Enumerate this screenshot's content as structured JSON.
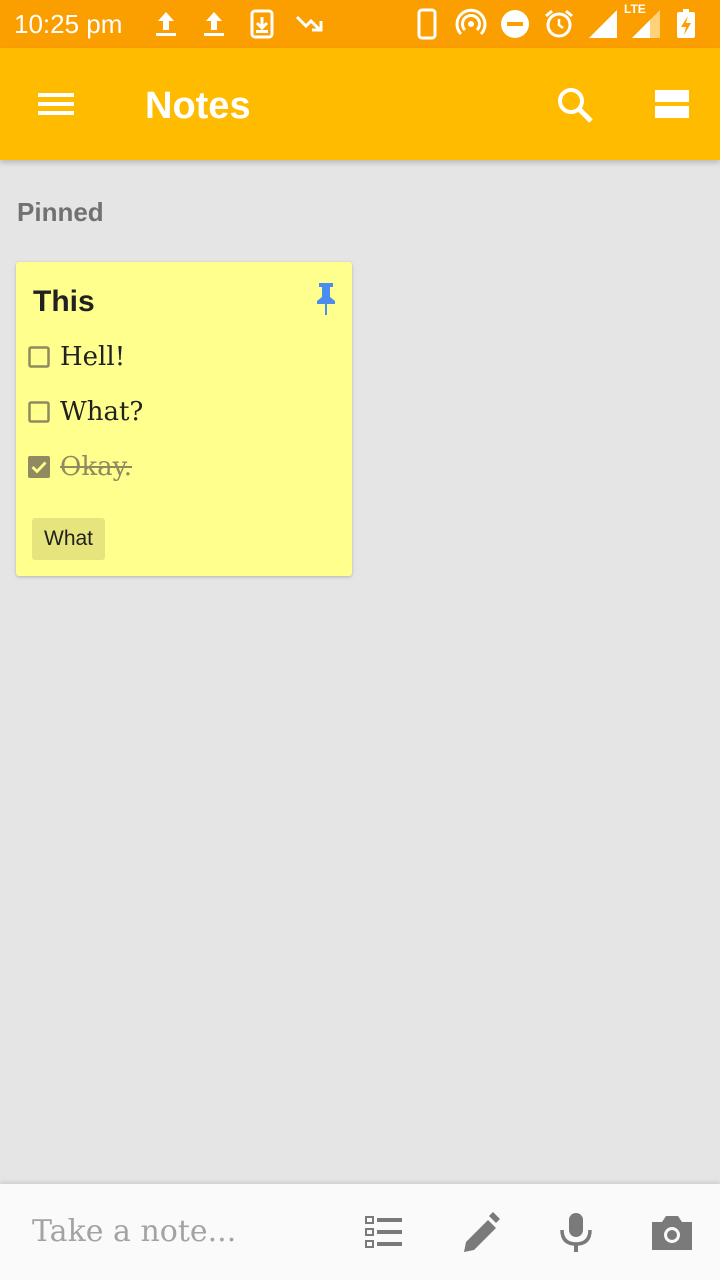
{
  "status_bar": {
    "time": "10:25 pm",
    "icons": [
      "upload-icon",
      "upload-icon",
      "download-icon",
      "trending-down-icon",
      "phone-icon",
      "hotspot-icon",
      "do-not-disturb-icon",
      "alarm-icon",
      "signal-icon",
      "lte-signal-icon",
      "battery-charging-icon"
    ],
    "lte_label": "LTE"
  },
  "app_bar": {
    "title": "Notes",
    "icons": [
      "menu-icon",
      "search-icon",
      "view-toggle-icon"
    ]
  },
  "colors": {
    "status_bar": "#fb9e00",
    "app_bar": "#ffbb00",
    "background": "#e5e5e5",
    "note_card": "#ffff8d",
    "label_chip": "#e6e57d",
    "pin": "#4a8cf0"
  },
  "main": {
    "section_label": "Pinned",
    "note": {
      "title": "This",
      "pinned": true,
      "items": [
        {
          "text": "Hell!",
          "checked": false
        },
        {
          "text": "What?",
          "checked": false
        },
        {
          "text": "Okay.",
          "checked": true
        }
      ],
      "label": "What"
    }
  },
  "bottom_bar": {
    "placeholder": "Take a note...",
    "icons": [
      "list-icon",
      "pen-icon",
      "mic-icon",
      "camera-icon"
    ]
  }
}
